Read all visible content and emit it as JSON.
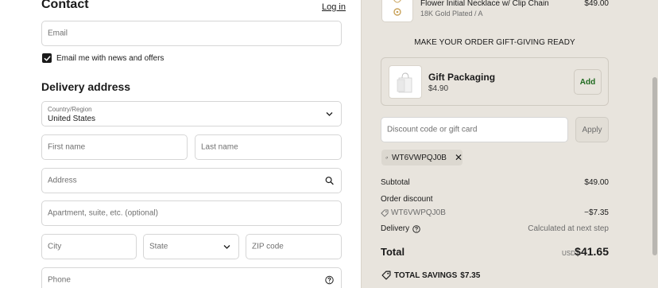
{
  "contact": {
    "heading": "Contact",
    "login_link": "Log in",
    "email_placeholder": "Email",
    "newsletter_label": "Email me with news and offers",
    "newsletter_checked": true
  },
  "delivery": {
    "heading": "Delivery address",
    "country_label": "Country/Region",
    "country_value": "United States",
    "first_name_placeholder": "First name",
    "last_name_placeholder": "Last name",
    "address_placeholder": "Address",
    "apartment_placeholder": "Apartment, suite, etc. (optional)",
    "city_placeholder": "City",
    "state_placeholder": "State",
    "zip_placeholder": "ZIP code",
    "phone_placeholder": "Phone"
  },
  "product": {
    "title": "Flower Initial Necklace w/ Clip Chain",
    "variant": "18K Gold Plated / A",
    "price": "$49.00"
  },
  "gift": {
    "heading": "MAKE YOUR ORDER GIFT-GIVING READY",
    "name": "Gift Packaging",
    "price": "$4.90",
    "add_label": "Add"
  },
  "discount": {
    "placeholder": "Discount code or gift card",
    "apply_label": "Apply",
    "applied_code": "WT6VWPQJ0B"
  },
  "summary": {
    "subtotal_label": "Subtotal",
    "subtotal_value": "$49.00",
    "order_discount_label": "Order discount",
    "discount_code": "WT6VWPQJ0B",
    "discount_value": "−$7.35",
    "delivery_label": "Delivery",
    "delivery_value": "Calculated at next step",
    "total_label": "Total",
    "currency": "USD",
    "total_value": "$41.65",
    "savings_label": "TOTAL SAVINGS",
    "savings_value": "$7.35"
  },
  "colors": {
    "summary_bg": "#e8e4dd",
    "add_button_text": "#1f6a1f",
    "checkbox_fill": "#1a1a1a"
  }
}
